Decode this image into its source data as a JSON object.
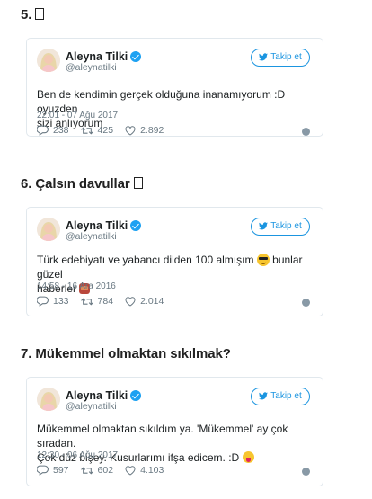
{
  "sections": [
    {
      "title": "5.",
      "title_glyph": true,
      "tweet": {
        "name": "Aleyna Tilki",
        "handle": "@aleynatilki",
        "follow_label": "Takip et",
        "text_line1": "Ben de kendimin gerçek olduğuna inanamıyorum :D oyuzden",
        "text_line2": "sizi anlıyorum",
        "timestamp": "22:01 - 07 Ağu 2017",
        "replies": "238",
        "retweets": "425",
        "likes": "2.892"
      }
    },
    {
      "title": "6. Çalsın davullar",
      "title_glyph": true,
      "tweet": {
        "name": "Aleyna Tilki",
        "handle": "@aleynatilki",
        "follow_label": "Takip et",
        "text_line1": "Türk edebiyatı ve yabancı dilden 100 almışım",
        "text_line1_after": "bunlar güzel",
        "text_line2": "haberler",
        "timestamp": "14:58 - 16 Ara 2016",
        "replies": "133",
        "retweets": "784",
        "likes": "2.014"
      }
    },
    {
      "title": "7. Mükemmel olmaktan sıkılmak?",
      "title_glyph": false,
      "tweet": {
        "name": "Aleyna Tilki",
        "handle": "@aleynatilki",
        "follow_label": "Takip et",
        "text_line1": "Mükemmel olmaktan sıkıldım ya. 'Mükemmel' ay çok sıradan.",
        "text_line2": "Çok düz bişey. Kusurlarımı ifşa edicem. :D",
        "timestamp": "12:30 - 06 Ağu 2017",
        "replies": "597",
        "retweets": "602",
        "likes": "4.103"
      }
    }
  ],
  "icons": {
    "verified": "verified-badge-icon",
    "bird": "twitter-bird-icon",
    "reply": "reply-icon",
    "retweet": "retweet-icon",
    "like": "heart-icon",
    "info": "info-icon"
  },
  "colors": {
    "accent": "#1b95e0",
    "verified": "#1da1f2",
    "muted": "#697882",
    "border": "#e1e8ed"
  }
}
